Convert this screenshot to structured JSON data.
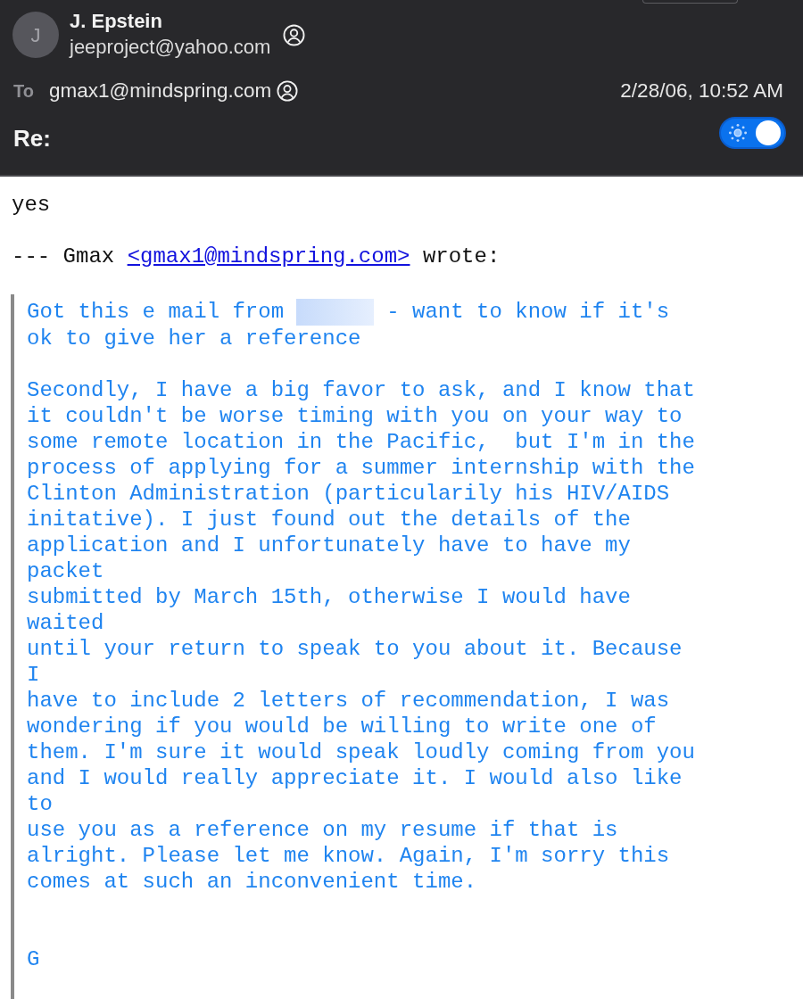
{
  "header": {
    "avatar_initial": "J",
    "sender_name": "J. Epstein",
    "sender_email": "jeeproject@yahoo.com",
    "to_label": "To",
    "recipient": "gmax1@mindspring.com",
    "date": "2/28/06, 10:52 AM",
    "subject": "Re:",
    "appearance_toggle": {
      "on": true
    }
  },
  "body": {
    "reply": "yes",
    "attribution": {
      "prefix": "--- Gmax",
      "link": "<gmax1@mindspring.com>",
      "suffix": "wrote:"
    },
    "quote": {
      "paragraphs": [
        {
          "segments": [
            {
              "kind": "text",
              "text": "Got this e mail from "
            },
            {
              "kind": "redaction"
            },
            {
              "kind": "text",
              "text": " - want to know if it's\nok to give her a reference"
            }
          ]
        },
        {
          "segments": [
            {
              "kind": "text",
              "text": "Secondly, I have a big favor to ask, and I know that\nit couldn't be worse timing with you on your way to\nsome remote location in the Pacific,  but I'm in the\nprocess of applying for a summer internship with the\nClinton Administration (particularily his HIV/AIDS\ninitative). I just found out the details of the\napplication and I unfortunately have to have my\npacket\nsubmitted by March 15th, otherwise I would have\nwaited\nuntil your return to speak to you about it. Because\nI\nhave to include 2 letters of recommendation, I was\nwondering if you would be willing to write one of\nthem. I'm sure it would speak loudly coming from you\nand I would really appreciate it. I would also like\nto\nuse you as a reference on my resume if that is\nalright. Please let me know. Again, I'm sorry this\ncomes at such an inconvenient time."
            }
          ]
        }
      ],
      "signature": "G"
    }
  }
}
